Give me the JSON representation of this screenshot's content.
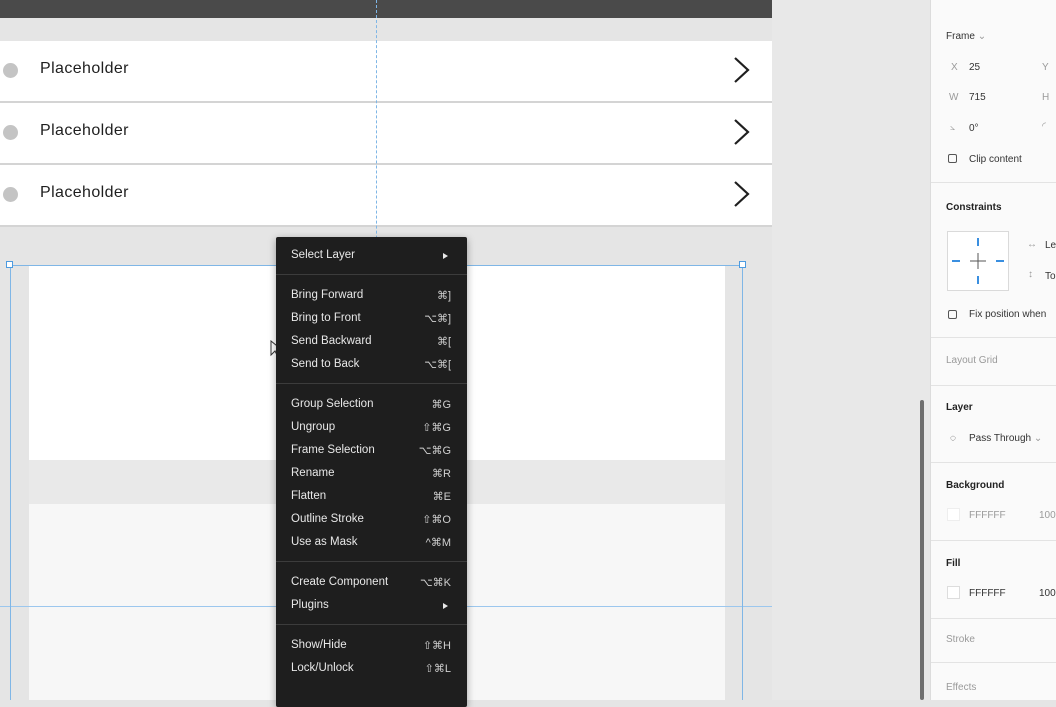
{
  "canvas": {
    "list_items": [
      {
        "label": "Placeholder"
      },
      {
        "label": "Placeholder"
      },
      {
        "label": "Placeholder"
      }
    ]
  },
  "context_menu": {
    "groups": [
      [
        {
          "label": "Select Layer",
          "shortcut": "",
          "submenu": true
        }
      ],
      [
        {
          "label": "Bring Forward",
          "shortcut": "⌘]"
        },
        {
          "label": "Bring to Front",
          "shortcut": "⌥⌘]"
        },
        {
          "label": "Send Backward",
          "shortcut": "⌘["
        },
        {
          "label": "Send to Back",
          "shortcut": "⌥⌘["
        }
      ],
      [
        {
          "label": "Group Selection",
          "shortcut": "⌘G"
        },
        {
          "label": "Ungroup",
          "shortcut": "⇧⌘G"
        },
        {
          "label": "Frame Selection",
          "shortcut": "⌥⌘G"
        },
        {
          "label": "Rename",
          "shortcut": "⌘R"
        },
        {
          "label": "Flatten",
          "shortcut": "⌘E"
        },
        {
          "label": "Outline Stroke",
          "shortcut": "⇧⌘O"
        },
        {
          "label": "Use as Mask",
          "shortcut": "^⌘M"
        }
      ],
      [
        {
          "label": "Create Component",
          "shortcut": "⌥⌘K"
        },
        {
          "label": "Plugins",
          "shortcut": "",
          "submenu": true
        }
      ],
      [
        {
          "label": "Show/Hide",
          "shortcut": "⇧⌘H"
        },
        {
          "label": "Lock/Unlock",
          "shortcut": "⇧⌘L"
        }
      ]
    ]
  },
  "panel": {
    "frame": {
      "title": "Frame",
      "x_label": "X",
      "x_value": "25",
      "y_label": "Y",
      "w_label": "W",
      "w_value": "715",
      "h_label": "H",
      "rotation": "0°",
      "clip_content": "Clip content"
    },
    "constraints": {
      "title": "Constraints",
      "horizontal": "Le",
      "vertical": "To",
      "fix_position": "Fix position when"
    },
    "layout_grid": {
      "title": "Layout Grid"
    },
    "layer": {
      "title": "Layer",
      "blend": "Pass Through"
    },
    "background": {
      "title": "Background",
      "hex": "FFFFFF",
      "opacity": "100"
    },
    "fill": {
      "title": "Fill",
      "hex": "FFFFFF",
      "opacity": "100"
    },
    "stroke": {
      "title": "Stroke"
    },
    "effects": {
      "title": "Effects"
    }
  },
  "colors": {
    "menu_bg": "#1e1e1e",
    "guide": "#7fb6e6",
    "panel_bg": "#fafafa"
  }
}
